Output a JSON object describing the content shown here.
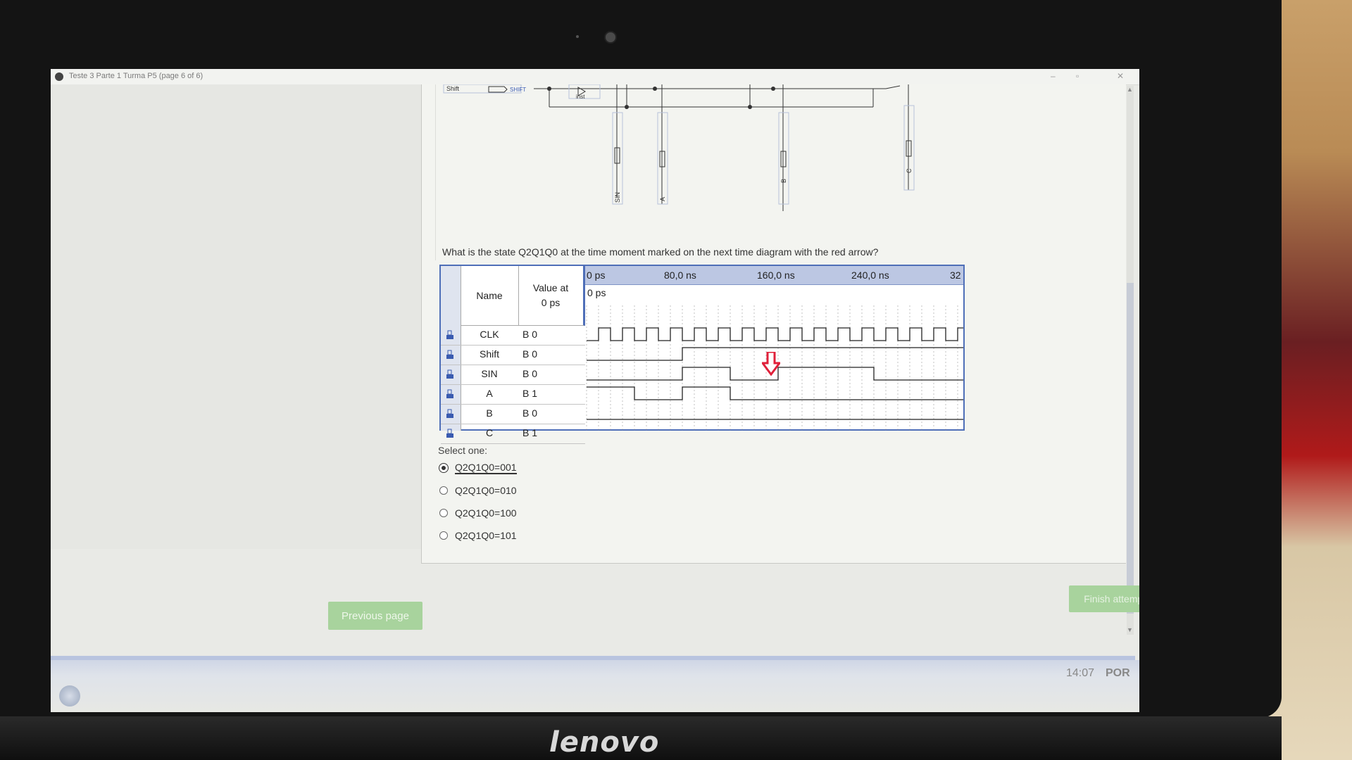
{
  "window": {
    "title": "Teste 3 Parte 1 Turma P5 (page 6 of 6)",
    "minimize": "–",
    "maximize": "▫",
    "close": "✕"
  },
  "schematic": {
    "labels": [
      "Shift",
      "inst",
      "SIN",
      "A",
      "B",
      "C"
    ]
  },
  "question": {
    "text": "What is the state Q2Q1Q0 at the time moment marked on the next time diagram with the red arrow?"
  },
  "waveform": {
    "header_name": "Name",
    "header_value_line1": "Value at",
    "header_value_line2": "0 ps",
    "time_ticks": [
      "0 ps",
      "80,0 ns",
      "160,0 ns",
      "240,0 ns",
      "32"
    ],
    "cursor_label": "0 ps",
    "signals": [
      {
        "name": "CLK",
        "value": "B 0",
        "levels": [
          0,
          1,
          0,
          1,
          0,
          1,
          0,
          1,
          0,
          1,
          0,
          1,
          0,
          1,
          0,
          1,
          0,
          1,
          0,
          1,
          0,
          1,
          0,
          1,
          0,
          1,
          0,
          1,
          0,
          1,
          0,
          1
        ]
      },
      {
        "name": "Shift",
        "value": "B 0",
        "levels": [
          0,
          0,
          0,
          0,
          0,
          0,
          0,
          0,
          1,
          1,
          1,
          1,
          1,
          1,
          1,
          1,
          1,
          1,
          1,
          1,
          1,
          1,
          1,
          1,
          1,
          1,
          1,
          1,
          1,
          1,
          1,
          1
        ]
      },
      {
        "name": "SIN",
        "value": "B 0",
        "levels": [
          0,
          0,
          0,
          0,
          0,
          0,
          0,
          0,
          1,
          1,
          1,
          1,
          0,
          0,
          0,
          0,
          1,
          1,
          1,
          1,
          1,
          1,
          1,
          1,
          0,
          0,
          0,
          0,
          0,
          0,
          0,
          0
        ]
      },
      {
        "name": "A",
        "value": "B 1",
        "levels": [
          1,
          1,
          1,
          1,
          0,
          0,
          0,
          0,
          1,
          1,
          1,
          1,
          0,
          0,
          0,
          0,
          0,
          0,
          0,
          0,
          0,
          0,
          0,
          0,
          0,
          0,
          0,
          0,
          0,
          0,
          0,
          0
        ]
      },
      {
        "name": "B",
        "value": "B 0",
        "levels": [
          0,
          0,
          0,
          0,
          0,
          0,
          0,
          0,
          0,
          0,
          0,
          0,
          0,
          0,
          0,
          0,
          0,
          0,
          0,
          0,
          0,
          0,
          0,
          0,
          0,
          0,
          0,
          0,
          0,
          0,
          0,
          0
        ]
      },
      {
        "name": "C",
        "value": "B 1",
        "levels": []
      }
    ],
    "arrow_color": "#e0203a"
  },
  "answers": {
    "select_label": "Select one:",
    "options": [
      {
        "label": "Q2Q1Q0=001",
        "selected": true
      },
      {
        "label": "Q2Q1Q0=010",
        "selected": false
      },
      {
        "label": "Q2Q1Q0=100",
        "selected": false
      },
      {
        "label": "Q2Q1Q0=101",
        "selected": false
      }
    ]
  },
  "navigation": {
    "previous": "Previous page",
    "finish": "Finish attempt ..."
  },
  "taskbar": {
    "time": "14:07",
    "language": "POR"
  },
  "device": {
    "brand": "lenovo"
  },
  "colors": {
    "accent_button": "#a8d39d",
    "wave_border": "#4f6fb8",
    "time_bar": "#bcc7e3"
  }
}
